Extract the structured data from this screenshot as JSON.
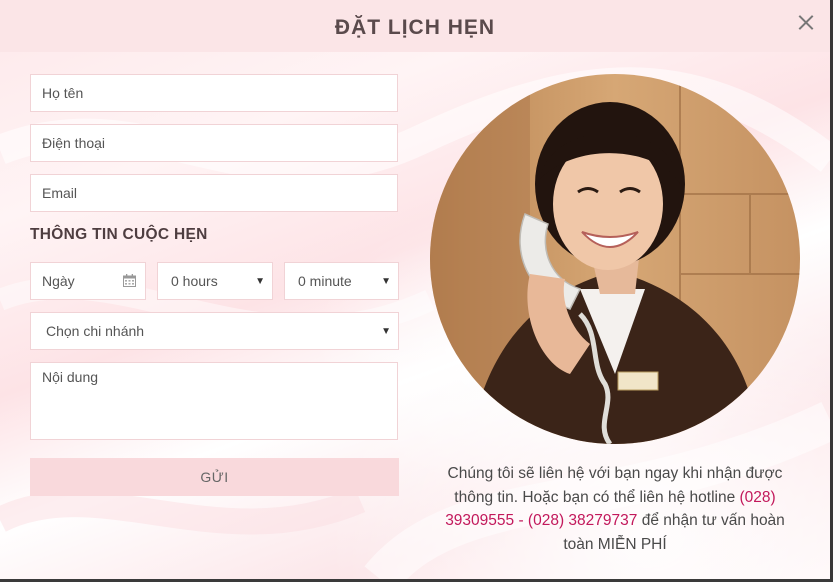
{
  "modal": {
    "title": "ĐẶT LỊCH HẸN"
  },
  "form": {
    "name_placeholder": "Họ tên",
    "phone_placeholder": "Điện thoại",
    "email_placeholder": "Email",
    "section_title": "THÔNG TIN CUỘC HẸN",
    "date_placeholder": "Ngày",
    "hours_value": "0 hours",
    "minute_value": "0 minute",
    "branch_value": "Chọn chi nhánh",
    "content_placeholder": "Nội dung",
    "submit_label": "GỬI"
  },
  "info": {
    "text_before": "Chúng tôi sẽ liên hệ với bạn ngay khi nhận được thông tin. Hoặc bạn có thể liên hệ hotline ",
    "hotline": "(028) 39309555 - (028) 38279737",
    "text_after": " để nhận tư vấn hoàn toàn MIỄN PHÍ"
  },
  "colors": {
    "header_bg": "#fbe5e7",
    "button_bg": "#f9d9dc",
    "hotline": "#c2185b"
  }
}
